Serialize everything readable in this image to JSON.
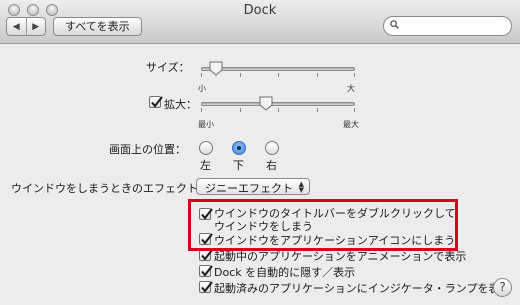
{
  "window": {
    "title": "Dock"
  },
  "toolbar": {
    "back_icon": "◀",
    "forward_icon": "▶",
    "show_all_label": "すべてを表示",
    "search_placeholder": "",
    "search_value": ""
  },
  "size": {
    "label": "サイズ：",
    "min_label": "小",
    "max_label": "大",
    "value_fraction": 0.1
  },
  "magnification": {
    "label": "拡大：",
    "checked": true,
    "min_label": "最小",
    "max_label": "最大",
    "value_fraction": 0.42
  },
  "position": {
    "label": "画面上の位置：",
    "options": [
      {
        "label": "左",
        "selected": false
      },
      {
        "label": "下",
        "selected": true
      },
      {
        "label": "右",
        "selected": false
      }
    ]
  },
  "minimize_effect": {
    "label": "ウインドウをしまうときのエフェクト：",
    "value": "ジニーエフェクト"
  },
  "options": {
    "double_click_line1": "ウインドウのタイトルバーをダブルクリックして",
    "double_click_line2": "ウインドウをしまう",
    "minimize_into_icon": "ウインドウをアプリケーションアイコンにしまう",
    "animate_opening": "起動中のアプリケーションをアニメーションで表示",
    "autohide": "Dock を自動的に隠す／表示",
    "show_indicators": "起動済みのアプリケーションにインジケータ・ランプを表示"
  },
  "help": {
    "label": "?"
  },
  "colors": {
    "highlight": "#d8001c",
    "accent": "#3f86e0"
  }
}
